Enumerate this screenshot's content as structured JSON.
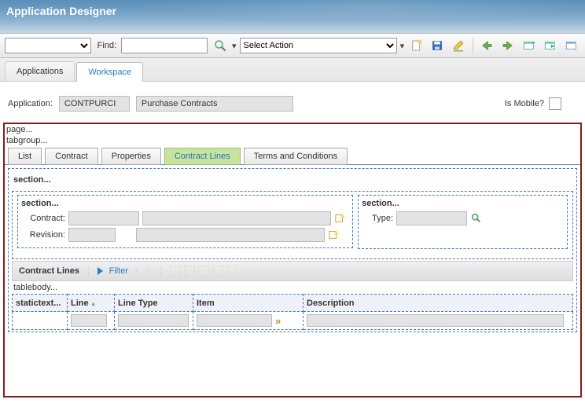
{
  "app_title": "Application Designer",
  "toolbar": {
    "find_label": "Find:",
    "action_placeholder": "Select Action"
  },
  "tabs": {
    "applications": "Applications",
    "workspace": "Workspace"
  },
  "info": {
    "app_label": "Application:",
    "app_code": "CONTPURCI",
    "app_desc": "Purchase Contracts",
    "is_mobile_label": "Is Mobile?"
  },
  "canvas": {
    "page_label": "page...",
    "tabgroup_label": "tabgroup...",
    "inner_tabs": {
      "list": "List",
      "contract": "Contract",
      "properties": "Properties",
      "contract_lines": "Contract Lines",
      "terms": "Terms and Conditions"
    },
    "section_label": "section...",
    "left": {
      "section_label": "section...",
      "contract_label": "Contract:",
      "revision_label": "Revision:"
    },
    "right": {
      "section_label": "section...",
      "type_label": "Type:"
    },
    "table": {
      "title": "Contract Lines",
      "filter": "Filter",
      "tablebody_label": "tablebody...",
      "cols": {
        "statictext": "statictext...",
        "line": "Line",
        "line_type": "Line Type",
        "item": "Item",
        "description": "Description"
      }
    }
  }
}
